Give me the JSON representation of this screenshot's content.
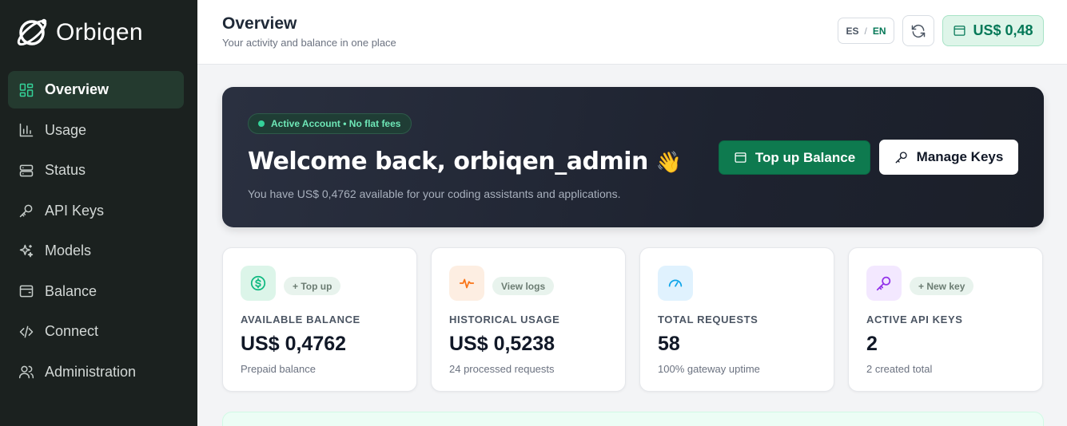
{
  "brand": {
    "name": "Orbiqen"
  },
  "sidebar": {
    "items": [
      {
        "label": "Overview",
        "icon": "grid-icon",
        "active": true
      },
      {
        "label": "Usage",
        "icon": "bar-chart-icon"
      },
      {
        "label": "Status",
        "icon": "server-icon"
      },
      {
        "label": "API Keys",
        "icon": "key-icon"
      },
      {
        "label": "Models",
        "icon": "sparkles-icon"
      },
      {
        "label": "Balance",
        "icon": "wallet-icon"
      },
      {
        "label": "Connect",
        "icon": "code-icon"
      },
      {
        "label": "Administration",
        "icon": "users-icon"
      }
    ]
  },
  "header": {
    "title": "Overview",
    "subtitle": "Your activity and balance in one place",
    "lang_es": "ES",
    "lang_sep": "/",
    "lang_en": "EN",
    "balance": "US$ 0,48"
  },
  "hero": {
    "status": "Active Account • No flat fees",
    "welcome": "Welcome back, orbiqen_admin",
    "wave": "👋",
    "subtitle": "You have US$ 0,4762 available for your coding assistants and applications.",
    "topup_label": "Top up Balance",
    "keys_label": "Manage Keys"
  },
  "cards": [
    {
      "tag": "+ Top up",
      "label": "AVAILABLE BALANCE",
      "value": "US$ 0,4762",
      "note": "Prepaid balance",
      "icon": "dollar-icon",
      "accent": "#10b981",
      "bg": "#dcf5e9"
    },
    {
      "tag": "View logs",
      "label": "HISTORICAL USAGE",
      "value": "US$ 0,5238",
      "note": "24 processed requests",
      "icon": "activity-icon",
      "accent": "#f97316",
      "bg": "#fdeee2"
    },
    {
      "tag": "",
      "label": "TOTAL REQUESTS",
      "value": "58",
      "note": "100% gateway uptime",
      "icon": "gauge-icon",
      "accent": "#0ea5e9",
      "bg": "#e0f2fe"
    },
    {
      "tag": "+ New key",
      "label": "ACTIVE API KEYS",
      "value": "2",
      "note": "2 created total",
      "icon": "key-icon",
      "accent": "#9333ea",
      "bg": "#f3e8ff"
    }
  ]
}
